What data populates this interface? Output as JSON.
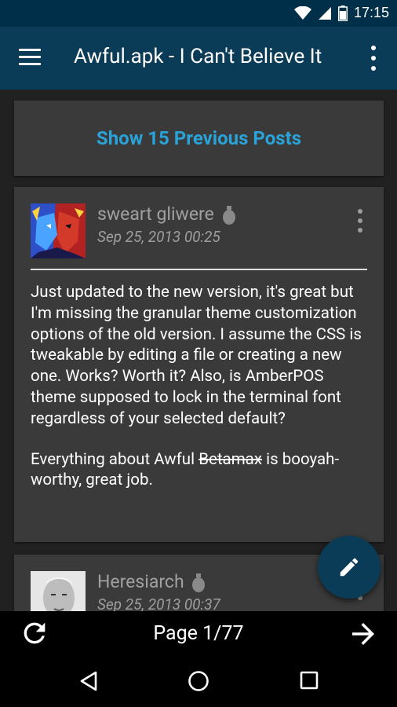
{
  "status_bar": {
    "time": "17:15",
    "icons": [
      "wifi-icon",
      "signal-icon",
      "battery-icon"
    ]
  },
  "app_bar": {
    "title": "Awful.apk - I Can't Believe It",
    "menu_icon": "hamburger-icon",
    "overflow_icon": "more-vert-icon"
  },
  "thread": {
    "previous_posts_label": "Show 15 Previous Posts",
    "posts": [
      {
        "username": "sweart gliwere",
        "date": "Sep 25, 2013 00:25",
        "body_p1": "Just updated to the new version, it's great but I'm missing the granular theme customization options of the old version. I assume the CSS is tweakable by editing a file or creating a new one. Works? Worth it? Also, is AmberPOS theme supposed to lock in the terminal font regardless of your selected default?",
        "body_p2_before": "Everything about Awful ",
        "body_p2_strike": "Betamax",
        "body_p2_after": " is booyah-worthy, great job."
      },
      {
        "username": "Heresiarch",
        "date": "Sep 25, 2013 00:37"
      }
    ]
  },
  "fab": {
    "icon": "edit-pencil-icon"
  },
  "pagination": {
    "label": "Page 1/77",
    "refresh_icon": "refresh-icon",
    "next_icon": "arrow-forward-icon"
  },
  "nav_bar": {
    "icons": [
      "back-icon",
      "home-icon",
      "recents-icon"
    ]
  },
  "colors": {
    "app_bar": "#0b3c57",
    "status_bar": "#003049",
    "accent": "#29a3d8",
    "card": "#3a3a3a",
    "background": "#212121"
  }
}
